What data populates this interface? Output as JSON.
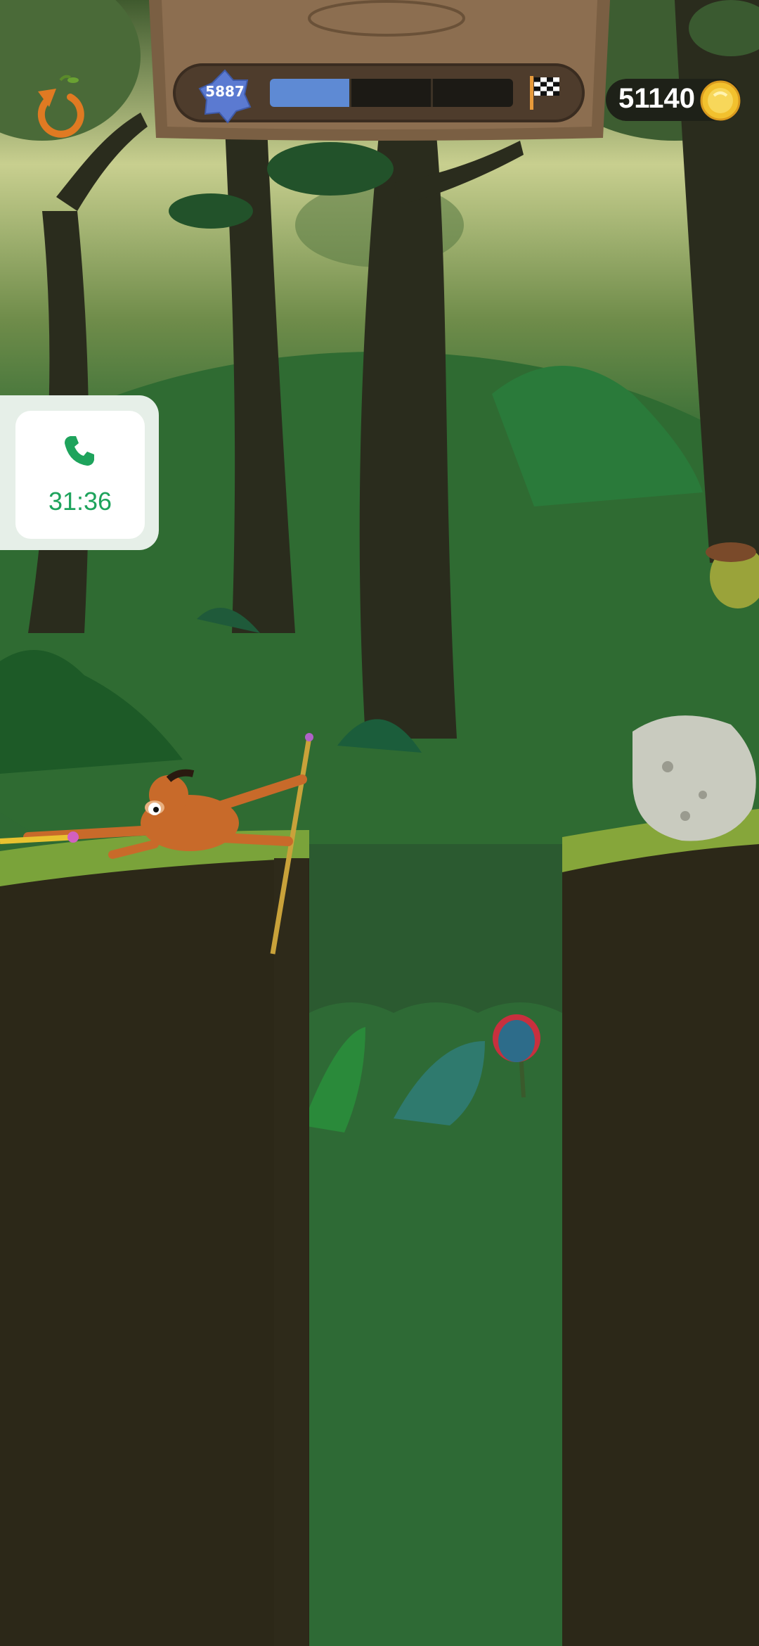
{
  "hud": {
    "level_number": "5887",
    "progress_fraction": 0.33,
    "progress_segments": 3,
    "coins": "51140"
  },
  "call_overlay": {
    "duration": "31:36"
  },
  "icons": [
    "restart-arrow-icon",
    "level-star-icon",
    "finish-flag-icon",
    "coin-icon",
    "phone-icon"
  ],
  "colors": {
    "progress_fill": "#5e8ad4",
    "call_green": "#1ea35c",
    "coin_gold": "#f2c12e"
  }
}
